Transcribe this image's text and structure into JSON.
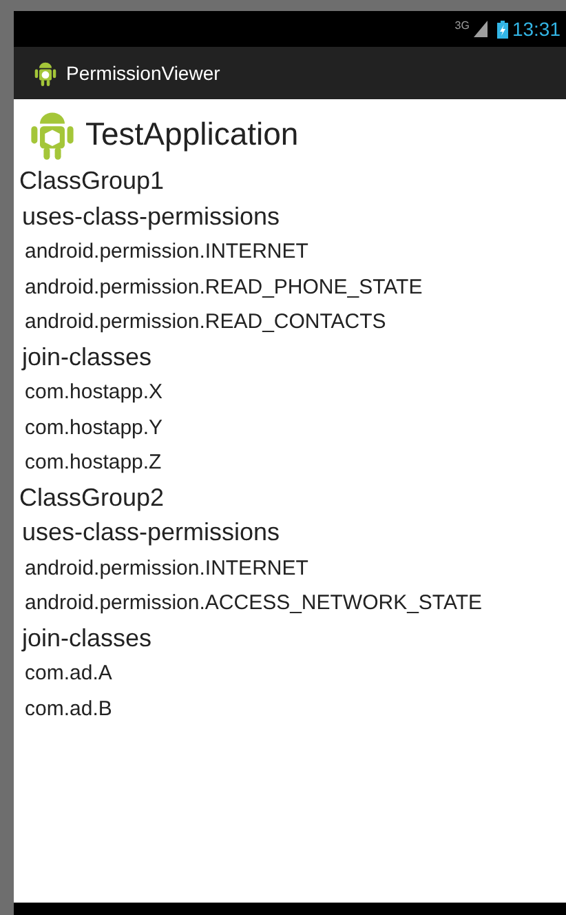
{
  "status_bar": {
    "network": "3G",
    "time": "13:31"
  },
  "action_bar": {
    "title": "PermissionViewer"
  },
  "app": {
    "title": "TestApplication"
  },
  "groups": [
    {
      "name": "ClassGroup1",
      "children": [
        {
          "name": "uses-class-permissions",
          "children": [
            {
              "name": "android.permission.INTERNET"
            },
            {
              "name": "android.permission.READ_PHONE_STATE"
            },
            {
              "name": "android.permission.READ_CONTACTS"
            }
          ]
        },
        {
          "name": "join-classes",
          "children": [
            {
              "name": "com.hostapp.X"
            },
            {
              "name": "com.hostapp.Y"
            },
            {
              "name": "com.hostapp.Z"
            }
          ]
        }
      ]
    },
    {
      "name": "ClassGroup2",
      "children": [
        {
          "name": "uses-class-permissions",
          "children": [
            {
              "name": "android.permission.INTERNET"
            },
            {
              "name": "android.permission.ACCESS_NETWORK_STATE"
            }
          ]
        },
        {
          "name": "join-classes",
          "children": [
            {
              "name": "com.ad.A"
            },
            {
              "name": "com.ad.B"
            }
          ]
        }
      ]
    }
  ]
}
